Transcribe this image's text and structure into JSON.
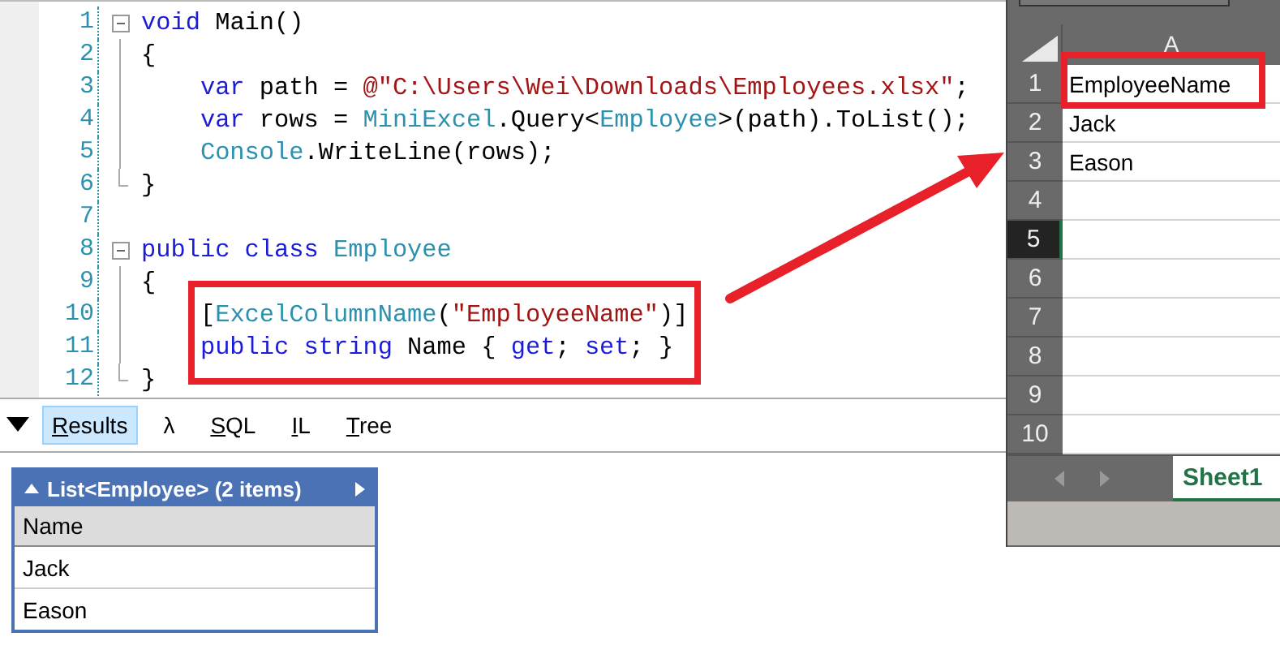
{
  "editor": {
    "lines": [
      {
        "number": "1",
        "kind": "start",
        "tokens": [
          {
            "kind": "kw",
            "text": "void"
          },
          {
            "kind": "plain",
            "text": " Main()"
          }
        ]
      },
      {
        "number": "2",
        "kind": "continue",
        "tokens": [
          {
            "kind": "plain",
            "text": "{"
          }
        ],
        "children": [
          {
            "number": "3",
            "kind": "continue",
            "tokens": [
              {
                "kind": "kw",
                "text": "var"
              },
              {
                "kind": "plain",
                "text": " path = "
              },
              {
                "kind": "str",
                "text": "@\"C:\\Users\\Wei\\Downloads\\Employees.xlsx\""
              },
              {
                "kind": "plain",
                "text": ";"
              }
            ]
          },
          {
            "number": "4",
            "kind": "continue",
            "tokens": [
              {
                "kind": "kw",
                "text": "var"
              },
              {
                "kind": "plain",
                "text": " rows = "
              },
              {
                "kind": "type",
                "text": "MiniExcel"
              },
              {
                "kind": "plain",
                "text": ".Query<"
              },
              {
                "kind": "type",
                "text": "Employee"
              },
              {
                "kind": "plain",
                "text": ">(path).ToList();"
              }
            ]
          },
          {
            "number": "5",
            "kind": "continue",
            "tokens": [
              {
                "kind": "type",
                "text": "Console"
              },
              {
                "kind": "plain",
                "text": ".WriteLine(rows);"
              }
            ]
          }
        ]
      },
      {
        "number": "6",
        "kind": "end",
        "tokens": [
          {
            "kind": "plain",
            "text": "}"
          }
        ]
      },
      {
        "number": "7",
        "kind": "blank"
      },
      {
        "number": "8",
        "kind": "start",
        "tokens": [
          {
            "kind": "kw",
            "text": "public class"
          },
          {
            "kind": "type",
            "text": " Employee"
          }
        ]
      },
      {
        "number": "9",
        "kind": "continue",
        "tokens": [
          {
            "kind": "plain",
            "text": "{"
          }
        ],
        "children": [
          {
            "number": "10",
            "kind": "continue",
            "tokens": [
              {
                "kind": "plain",
                "text": "["
              },
              {
                "kind": "type",
                "text": "ExcelColumnName"
              },
              {
                "kind": "plain",
                "text": "("
              },
              {
                "kind": "str",
                "text": "\"EmployeeName\""
              },
              {
                "kind": "plain",
                "text": ")]"
              }
            ]
          },
          {
            "number": "11",
            "kind": "continue",
            "tokens": [
              {
                "kind": "kw",
                "text": "public string"
              },
              {
                "kind": "plain",
                "text": " Name { "
              },
              {
                "kind": "kw",
                "text": "get"
              },
              {
                "kind": "plain",
                "text": "; "
              },
              {
                "kind": "kw",
                "text": "set"
              },
              {
                "kind": "plain",
                "text": "; }"
              }
            ]
          }
        ]
      },
      {
        "number": "12",
        "kind": "end",
        "tokens": [
          {
            "kind": "plain",
            "text": "}"
          }
        ]
      }
    ]
  },
  "output_tabs": [
    {
      "label": "Results",
      "selected": true,
      "underline_first": true
    },
    {
      "label": "λ",
      "selected": false,
      "underline_first": false
    },
    {
      "label": "SQL",
      "selected": false,
      "underline_first": true
    },
    {
      "label": "IL",
      "selected": false,
      "underline_first": true
    },
    {
      "label": "Tree",
      "selected": false,
      "underline_first": true
    }
  ],
  "result": {
    "title": "List<Employee> (2 items)",
    "columns": [
      "Name"
    ],
    "rows": [
      [
        "Jack"
      ],
      [
        "Eason"
      ]
    ]
  },
  "excel": {
    "column_header": "A",
    "rows": [
      {
        "number": "1",
        "value": "EmployeeName",
        "selected": false
      },
      {
        "number": "2",
        "value": "Jack",
        "selected": false
      },
      {
        "number": "3",
        "value": "Eason",
        "selected": false
      },
      {
        "number": "4",
        "selected": false
      },
      {
        "number": "5",
        "selected": true
      },
      {
        "number": "6",
        "selected": false
      },
      {
        "number": "7",
        "selected": false
      },
      {
        "number": "8",
        "selected": false
      },
      {
        "number": "9",
        "selected": false
      },
      {
        "number": "10",
        "selected": false
      }
    ],
    "sheet_tabs": [
      {
        "label": "Sheet1",
        "selected": true
      }
    ]
  }
}
